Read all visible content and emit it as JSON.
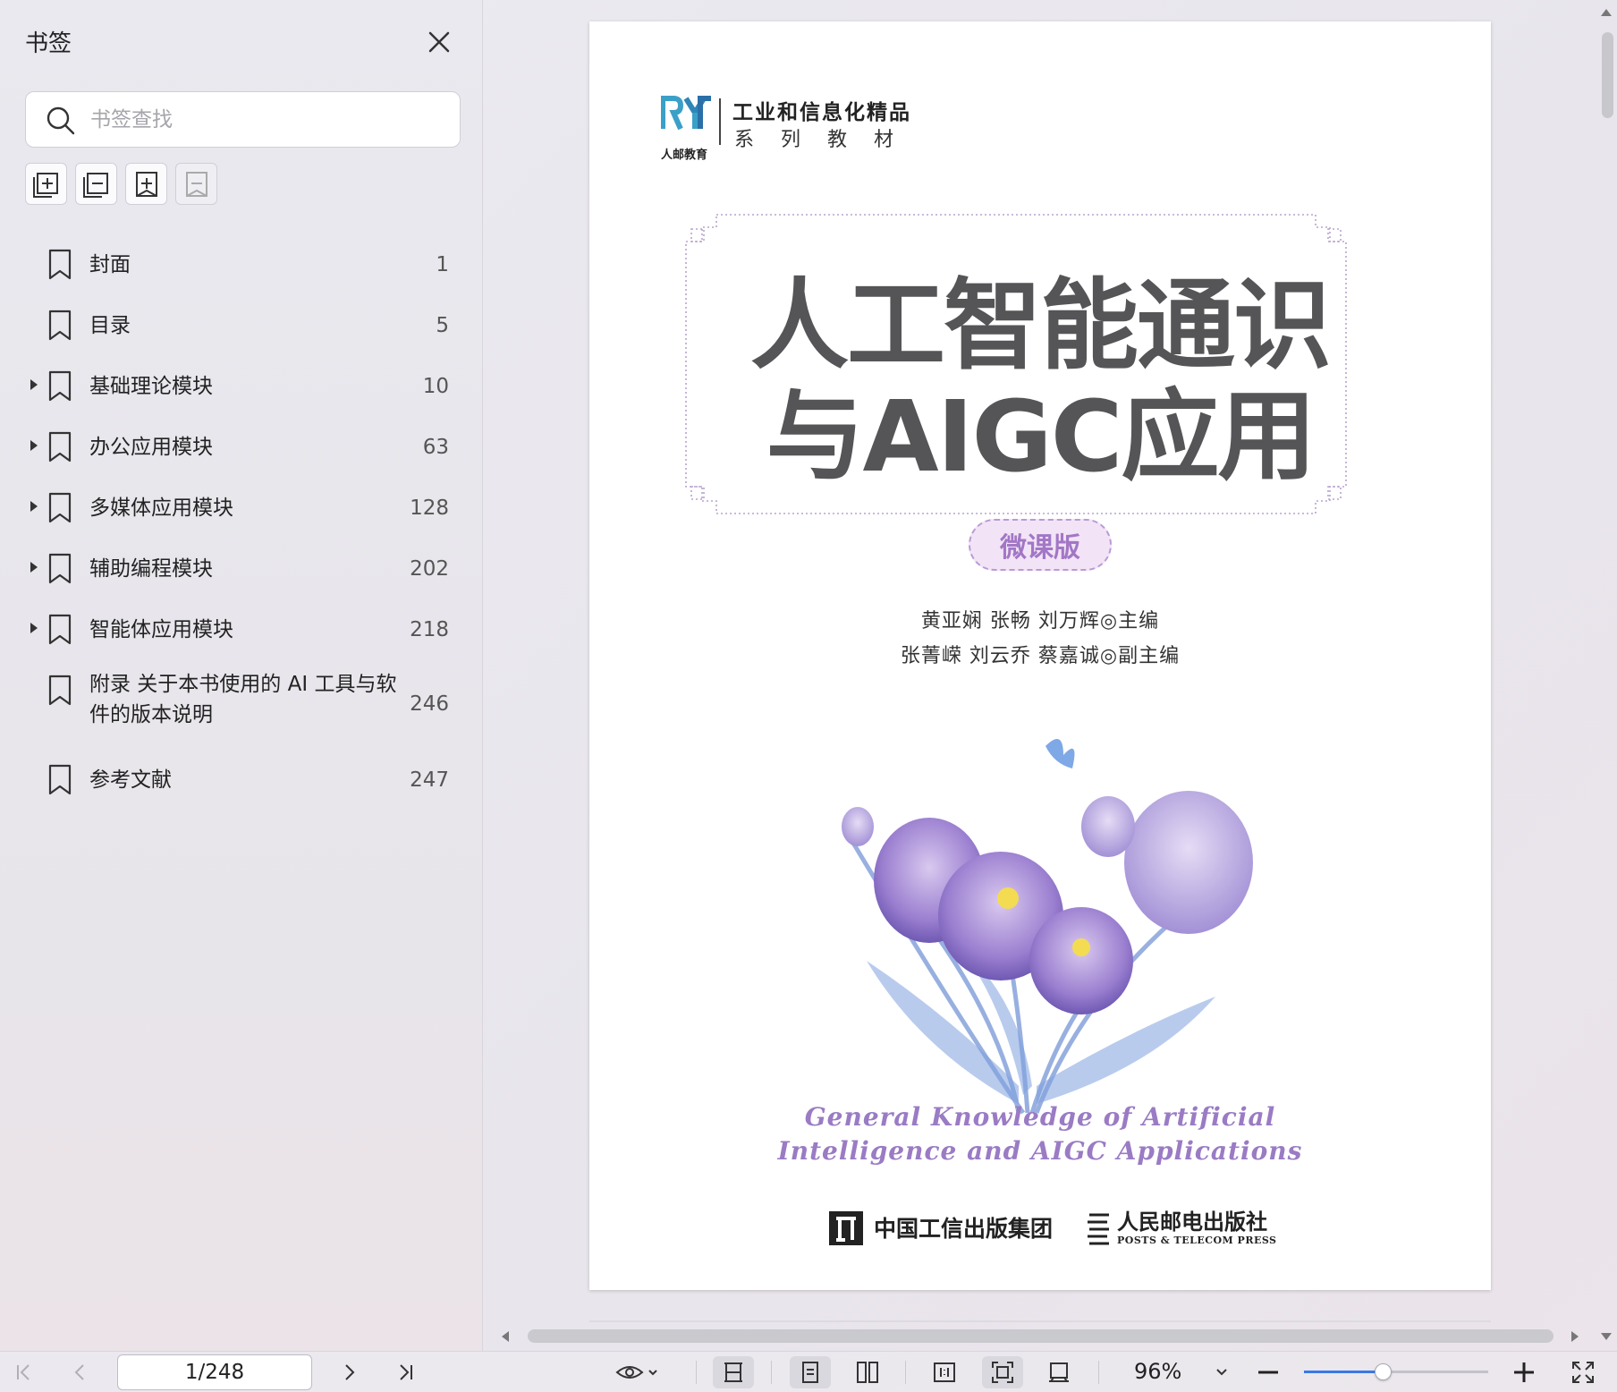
{
  "sidebar": {
    "title": "书签",
    "search_placeholder": "书签查找",
    "bookmarks": [
      {
        "label": "封面",
        "page": "1",
        "expandable": false
      },
      {
        "label": "目录",
        "page": "5",
        "expandable": false
      },
      {
        "label": "基础理论模块",
        "page": "10",
        "expandable": true
      },
      {
        "label": "办公应用模块",
        "page": "63",
        "expandable": true
      },
      {
        "label": "多媒体应用模块",
        "page": "128",
        "expandable": true
      },
      {
        "label": "辅助编程模块",
        "page": "202",
        "expandable": true
      },
      {
        "label": "智能体应用模块",
        "page": "218",
        "expandable": true
      },
      {
        "label": "附录 关于本书使用的 AI 工具与软件的版本说明",
        "page": "246",
        "expandable": false
      },
      {
        "label": "参考文献",
        "page": "247",
        "expandable": false
      }
    ]
  },
  "cover": {
    "logo_text": "人邮教育",
    "series_title": "工业和信息化精品",
    "series_sub": "系列教材",
    "title_line1": "人工智能通识",
    "title_line2": "与AIGC应用",
    "edition": "微课版",
    "authors_line1": "黄亚娴  张畅  刘万辉◎主编",
    "authors_line2": "张菁嵘  刘云乔  蔡嘉诚◎副主编",
    "english_line1": "General Knowledge of Artificial",
    "english_line2": "Intelligence and AIGC Applications",
    "publisher1": "中国工信出版集团",
    "publisher2": "人民邮电出版社",
    "publisher2_en": "POSTS & TELECOM PRESS"
  },
  "toolbar": {
    "page_indicator": "1/248",
    "zoom": "96%",
    "zoom_slider_fraction": 0.43
  },
  "colors": {
    "accent": "#3a78e6",
    "title_gray": "#555557",
    "lavender": "#9a7bc4"
  }
}
